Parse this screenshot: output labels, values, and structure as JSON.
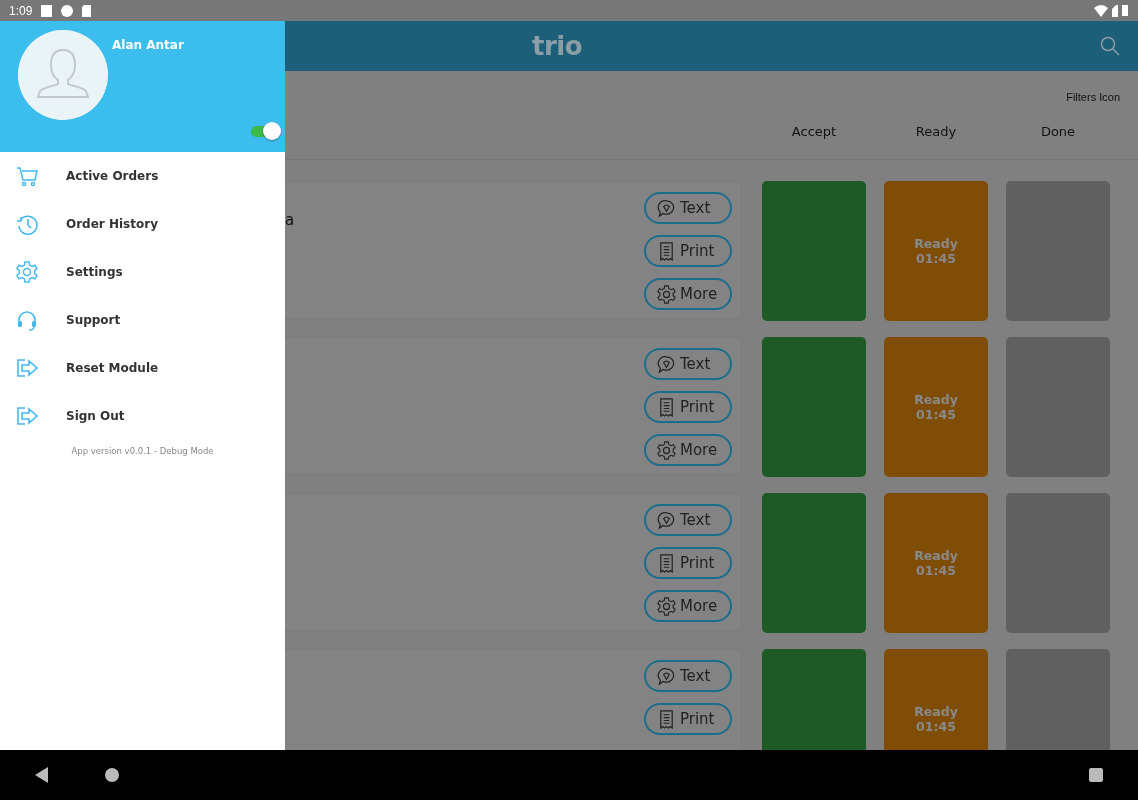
{
  "status_bar": {
    "time": "1:09"
  },
  "drawer": {
    "user_name": "Alan Antar",
    "online": true,
    "items": [
      {
        "label": "Active Orders",
        "kind": "cart"
      },
      {
        "label": "Order History",
        "kind": "history"
      },
      {
        "label": "Settings",
        "kind": "gear"
      },
      {
        "label": "Support",
        "kind": "headset"
      },
      {
        "label": "Reset Module",
        "kind": "exit"
      },
      {
        "label": "Sign Out",
        "kind": "exit"
      }
    ],
    "version": "App version v0.0.1 - Debug Mode"
  },
  "app_bar": {
    "logo": "trio"
  },
  "filters": "Filters Icon",
  "columns": [
    "Accept",
    "Ready",
    "Done"
  ],
  "orders": [
    {
      "title": "a",
      "actions": [
        {
          "label": "Text",
          "kind": "chat"
        },
        {
          "label": "Print",
          "kind": "receipt"
        },
        {
          "label": "More",
          "kind": "gear"
        }
      ],
      "tiles": [
        {
          "kind": "accept"
        },
        {
          "kind": "ready",
          "label": "Ready",
          "time": "01:45"
        },
        {
          "kind": "done"
        }
      ]
    },
    {
      "actions": [
        {
          "label": "Text",
          "kind": "chat"
        },
        {
          "label": "Print",
          "kind": "receipt"
        },
        {
          "label": "More",
          "kind": "gear"
        }
      ],
      "tiles": [
        {
          "kind": "accept"
        },
        {
          "kind": "ready",
          "label": "Ready",
          "time": "01:45"
        },
        {
          "kind": "done"
        }
      ]
    },
    {
      "actions": [
        {
          "label": "Text",
          "kind": "chat"
        },
        {
          "label": "Print",
          "kind": "receipt"
        },
        {
          "label": "More",
          "kind": "gear"
        }
      ],
      "tiles": [
        {
          "kind": "accept"
        },
        {
          "kind": "ready",
          "label": "Ready",
          "time": "01:45"
        },
        {
          "kind": "done"
        }
      ]
    },
    {
      "actions": [
        {
          "label": "Text",
          "kind": "chat"
        },
        {
          "label": "Print",
          "kind": "receipt"
        }
      ],
      "tiles": [
        {
          "kind": "accept"
        },
        {
          "kind": "ready",
          "label": "Ready",
          "time": "01:45"
        },
        {
          "kind": "done"
        }
      ]
    }
  ]
}
